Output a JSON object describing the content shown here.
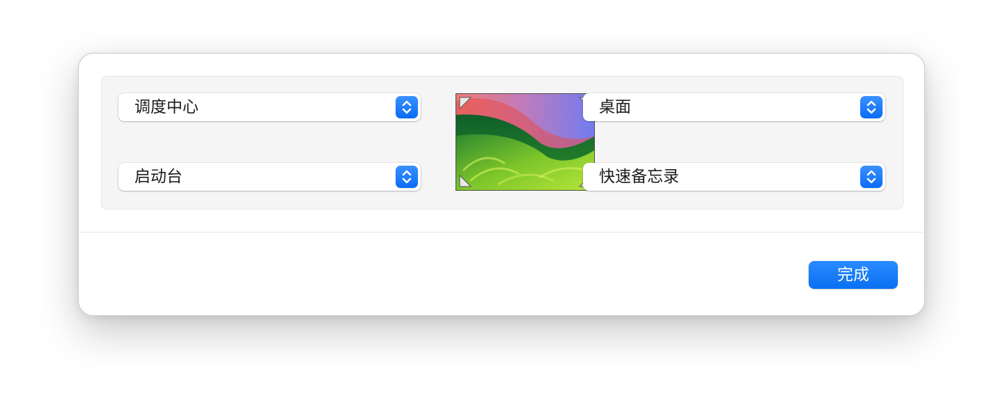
{
  "hot_corners": {
    "top_left": {
      "value": "调度中心"
    },
    "bottom_left": {
      "value": "启动台"
    },
    "top_right": {
      "value": "桌面"
    },
    "bottom_right": {
      "value": "快速备忘录"
    }
  },
  "preview": {
    "icons": {
      "corner_marker": "triangle-corner-icon",
      "stepper": "up-down-chevron-icon"
    }
  },
  "footer": {
    "done_label": "完成"
  },
  "colors": {
    "accent": "#0A72F5",
    "sheet_background": "#FFFFFF",
    "group_background": "#F5F5F5"
  }
}
